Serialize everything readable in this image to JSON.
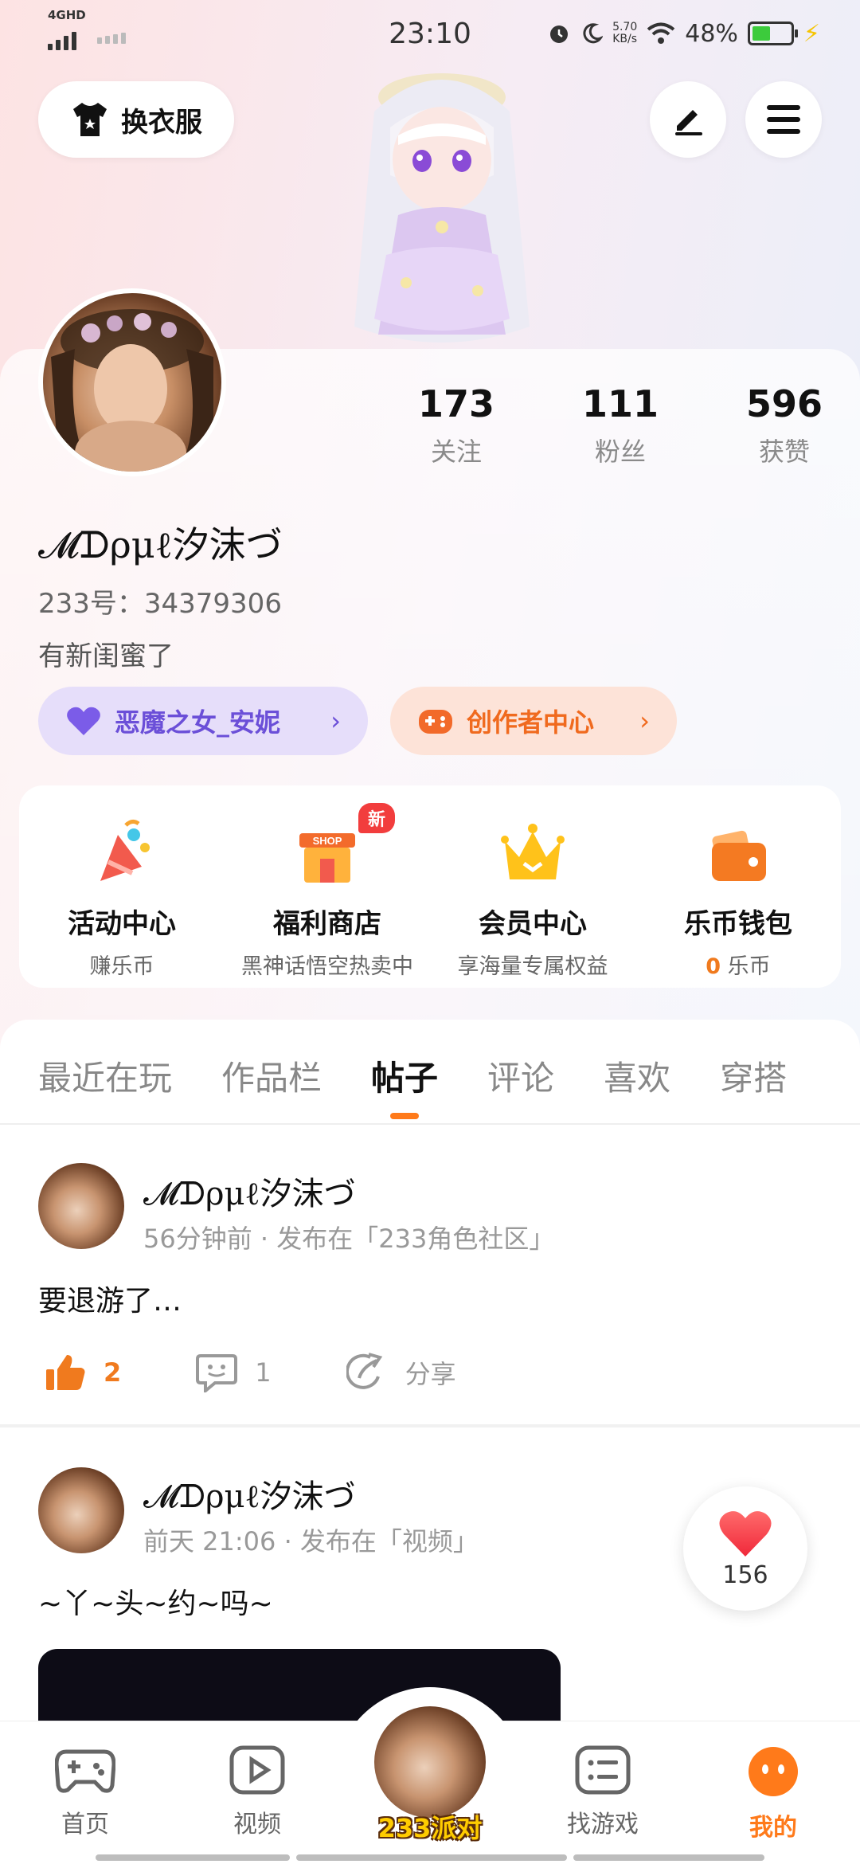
{
  "status_bar": {
    "network": "4GHD",
    "time": "23:10",
    "speed_value": "5.70",
    "speed_unit": "KB/s",
    "battery": "48%",
    "battery_level": 0.48
  },
  "header": {
    "outfit_label": "换衣服"
  },
  "profile": {
    "stats": [
      {
        "value": "173",
        "label": "关注"
      },
      {
        "value": "111",
        "label": "粉丝"
      },
      {
        "value": "596",
        "label": "获赞"
      }
    ],
    "username": "𝓜ᗪρμℓ汐沫づ",
    "uid": "233号：34379306",
    "bio": "有新闺蜜了",
    "guard_pill": "恶魔之女_安妮",
    "creator_pill": "创作者中心"
  },
  "features": [
    {
      "title": "活动中心",
      "subtitle": "赚乐币"
    },
    {
      "title": "福利商店",
      "subtitle": "黑神话悟空热卖中",
      "badge": "新"
    },
    {
      "title": "会员中心",
      "subtitle": "享海量专属权益"
    },
    {
      "title": "乐币钱包",
      "subtitle_value": "0",
      "subtitle_unit": " 乐币"
    }
  ],
  "tabs": [
    "最近在玩",
    "作品栏",
    "帖子",
    "评论",
    "喜欢",
    "穿搭"
  ],
  "active_tab": "帖子",
  "posts": [
    {
      "author": "𝓜ᗪρμℓ汐沫づ",
      "meta": "56分钟前 · 发布在「233角色社区」",
      "text": "要退游了…",
      "likes": "2",
      "comments": "1",
      "share": "分享"
    },
    {
      "author": "𝓜ᗪρμℓ汐沫づ",
      "meta": "前天 21:06 · 发布在「视频」",
      "text": "~丫~头~约~吗~"
    }
  ],
  "like_float": {
    "count": "156"
  },
  "bottom_nav": {
    "home": "首页",
    "video": "视频",
    "party": "233派对",
    "games": "找游戏",
    "me": "我的"
  },
  "colors": {
    "accent": "#ff7a1a",
    "guard_purple": "#6b4fd8",
    "like_red": "#f23d3d"
  }
}
